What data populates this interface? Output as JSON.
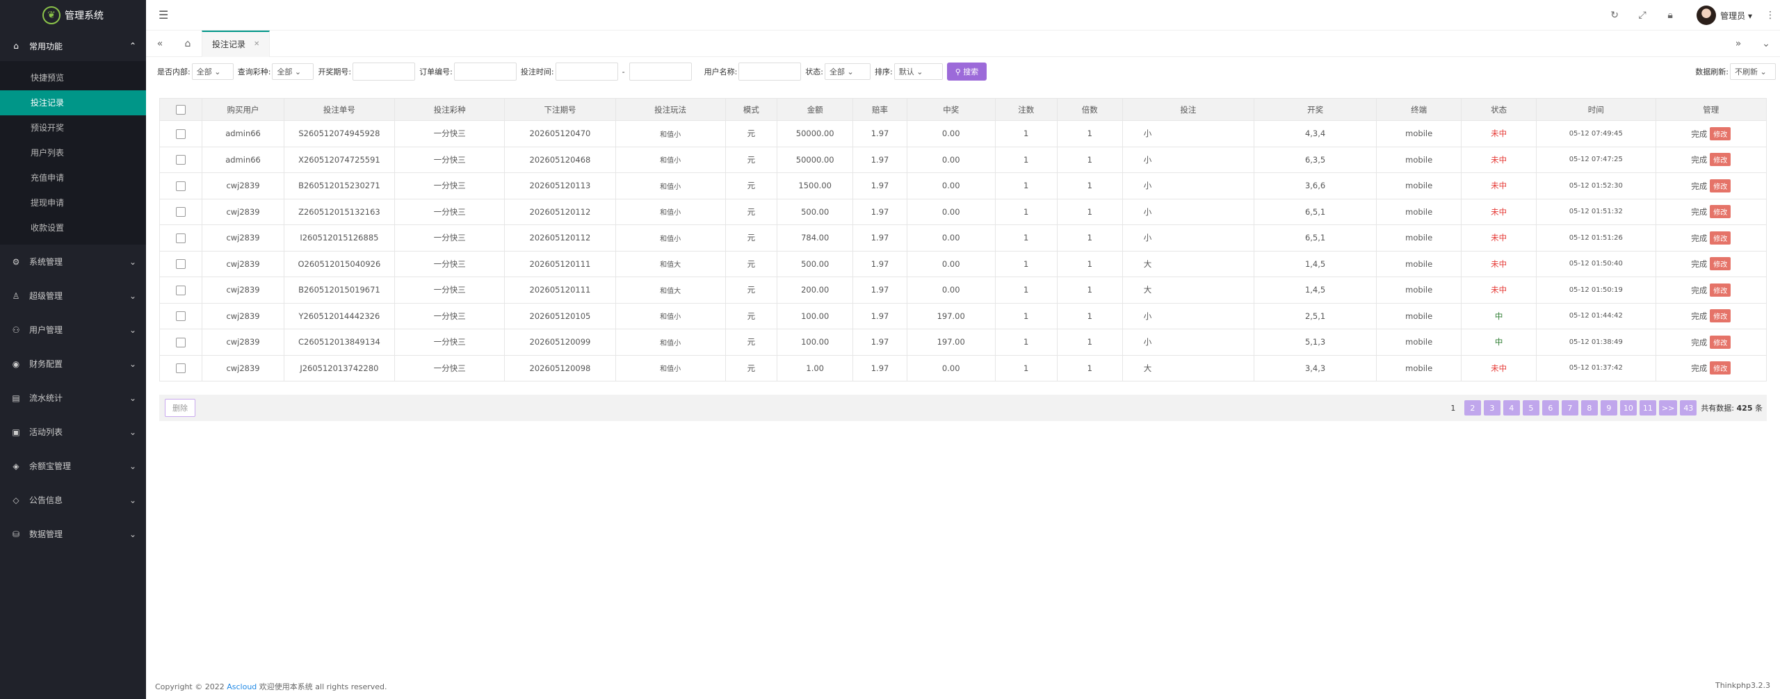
{
  "sidebar": {
    "title": "管理系统",
    "groups": [
      {
        "label": "常用功能",
        "icon": "home-icon",
        "items": [
          "快捷预览",
          "投注记录",
          "预设开奖",
          "用户列表",
          "充值申请",
          "提现申请",
          "收款设置"
        ]
      },
      {
        "label": "系统管理",
        "icon": "gear-icon"
      },
      {
        "label": "超级管理",
        "icon": "user-icon"
      },
      {
        "label": "用户管理",
        "icon": "users-icon"
      },
      {
        "label": "财务配置",
        "icon": "money-icon"
      },
      {
        "label": "流水统计",
        "icon": "chart-icon"
      },
      {
        "label": "活动列表",
        "icon": "gift-icon"
      },
      {
        "label": "余额宝管理",
        "icon": "diamond-icon"
      },
      {
        "label": "公告信息",
        "icon": "bell-icon"
      },
      {
        "label": "数据管理",
        "icon": "database-icon"
      }
    ]
  },
  "header": {
    "user": "管理员"
  },
  "tabs": {
    "active": "投注记录"
  },
  "filters": {
    "internal_label": "是否内部:",
    "internal_value": "全部",
    "lottery_label": "查询彩种:",
    "lottery_value": "全部",
    "period_label": "开奖期号:",
    "order_label": "订单编号:",
    "time_label": "投注时间:",
    "time_sep": "-",
    "user_label": "用户名称:",
    "status_label": "状态:",
    "status_value": "全部",
    "sort_label": "排序:",
    "sort_value": "默认",
    "search_button": "搜索",
    "refresh_label": "数据刷新:",
    "refresh_value": "不刷新"
  },
  "table": {
    "headers": [
      "购买用户",
      "投注单号",
      "投注彩种",
      "下注期号",
      "投注玩法",
      "模式",
      "金额",
      "赔率",
      "中奖",
      "注数",
      "倍数",
      "投注",
      "开奖",
      "终端",
      "状态",
      "时间",
      "管理"
    ],
    "rows": [
      [
        "admin66",
        "S260512074945928",
        "一分快三",
        "202605120470",
        "和值小",
        "元",
        "50000.00",
        "1.97",
        "0.00",
        "1",
        "1",
        "小",
        "4,3,4",
        "mobile",
        "未中",
        "05-12 07:49:45"
      ],
      [
        "admin66",
        "X260512074725591",
        "一分快三",
        "202605120468",
        "和值小",
        "元",
        "50000.00",
        "1.97",
        "0.00",
        "1",
        "1",
        "小",
        "6,3,5",
        "mobile",
        "未中",
        "05-12 07:47:25"
      ],
      [
        "cwj2839",
        "B260512015230271",
        "一分快三",
        "202605120113",
        "和值小",
        "元",
        "1500.00",
        "1.97",
        "0.00",
        "1",
        "1",
        "小",
        "3,6,6",
        "mobile",
        "未中",
        "05-12 01:52:30"
      ],
      [
        "cwj2839",
        "Z260512015132163",
        "一分快三",
        "202605120112",
        "和值小",
        "元",
        "500.00",
        "1.97",
        "0.00",
        "1",
        "1",
        "小",
        "6,5,1",
        "mobile",
        "未中",
        "05-12 01:51:32"
      ],
      [
        "cwj2839",
        "I260512015126885",
        "一分快三",
        "202605120112",
        "和值小",
        "元",
        "784.00",
        "1.97",
        "0.00",
        "1",
        "1",
        "小",
        "6,5,1",
        "mobile",
        "未中",
        "05-12 01:51:26"
      ],
      [
        "cwj2839",
        "O260512015040926",
        "一分快三",
        "202605120111",
        "和值大",
        "元",
        "500.00",
        "1.97",
        "0.00",
        "1",
        "1",
        "大",
        "1,4,5",
        "mobile",
        "未中",
        "05-12 01:50:40"
      ],
      [
        "cwj2839",
        "B260512015019671",
        "一分快三",
        "202605120111",
        "和值大",
        "元",
        "200.00",
        "1.97",
        "0.00",
        "1",
        "1",
        "大",
        "1,4,5",
        "mobile",
        "未中",
        "05-12 01:50:19"
      ],
      [
        "cwj2839",
        "Y260512014442326",
        "一分快三",
        "202605120105",
        "和值小",
        "元",
        "100.00",
        "1.97",
        "197.00",
        "1",
        "1",
        "小",
        "2,5,1",
        "mobile",
        "中",
        "05-12 01:44:42"
      ],
      [
        "cwj2839",
        "C260512013849134",
        "一分快三",
        "202605120099",
        "和值小",
        "元",
        "100.00",
        "1.97",
        "197.00",
        "1",
        "1",
        "小",
        "5,1,3",
        "mobile",
        "中",
        "05-12 01:38:49"
      ],
      [
        "cwj2839",
        "J260512013742280",
        "一分快三",
        "202605120098",
        "和值小",
        "元",
        "1.00",
        "1.97",
        "0.00",
        "1",
        "1",
        "大",
        "3,4,3",
        "mobile",
        "未中",
        "05-12 01:37:42"
      ]
    ],
    "manage_done": "完成",
    "manage_edit": "修改"
  },
  "actions": {
    "delete": "删除"
  },
  "pager": {
    "pages": [
      "1",
      "2",
      "3",
      "4",
      "5",
      "6",
      "7",
      "8",
      "9",
      "10",
      "11",
      ">>",
      "43"
    ],
    "total_label": "共有数据:",
    "total_count": "425",
    "total_unit": "条"
  },
  "footer": {
    "copyright": "Copyright © 2022",
    "brand": "Ascloud",
    "rest": "欢迎使用本系统 all rights reserved.",
    "version": "Thinkphp3.2.3"
  },
  "colors": {
    "accent": "#009688",
    "sidebar": "#20222a",
    "button": "#9c6ad9",
    "lose": "#e53935",
    "win": "#2e7d32"
  }
}
